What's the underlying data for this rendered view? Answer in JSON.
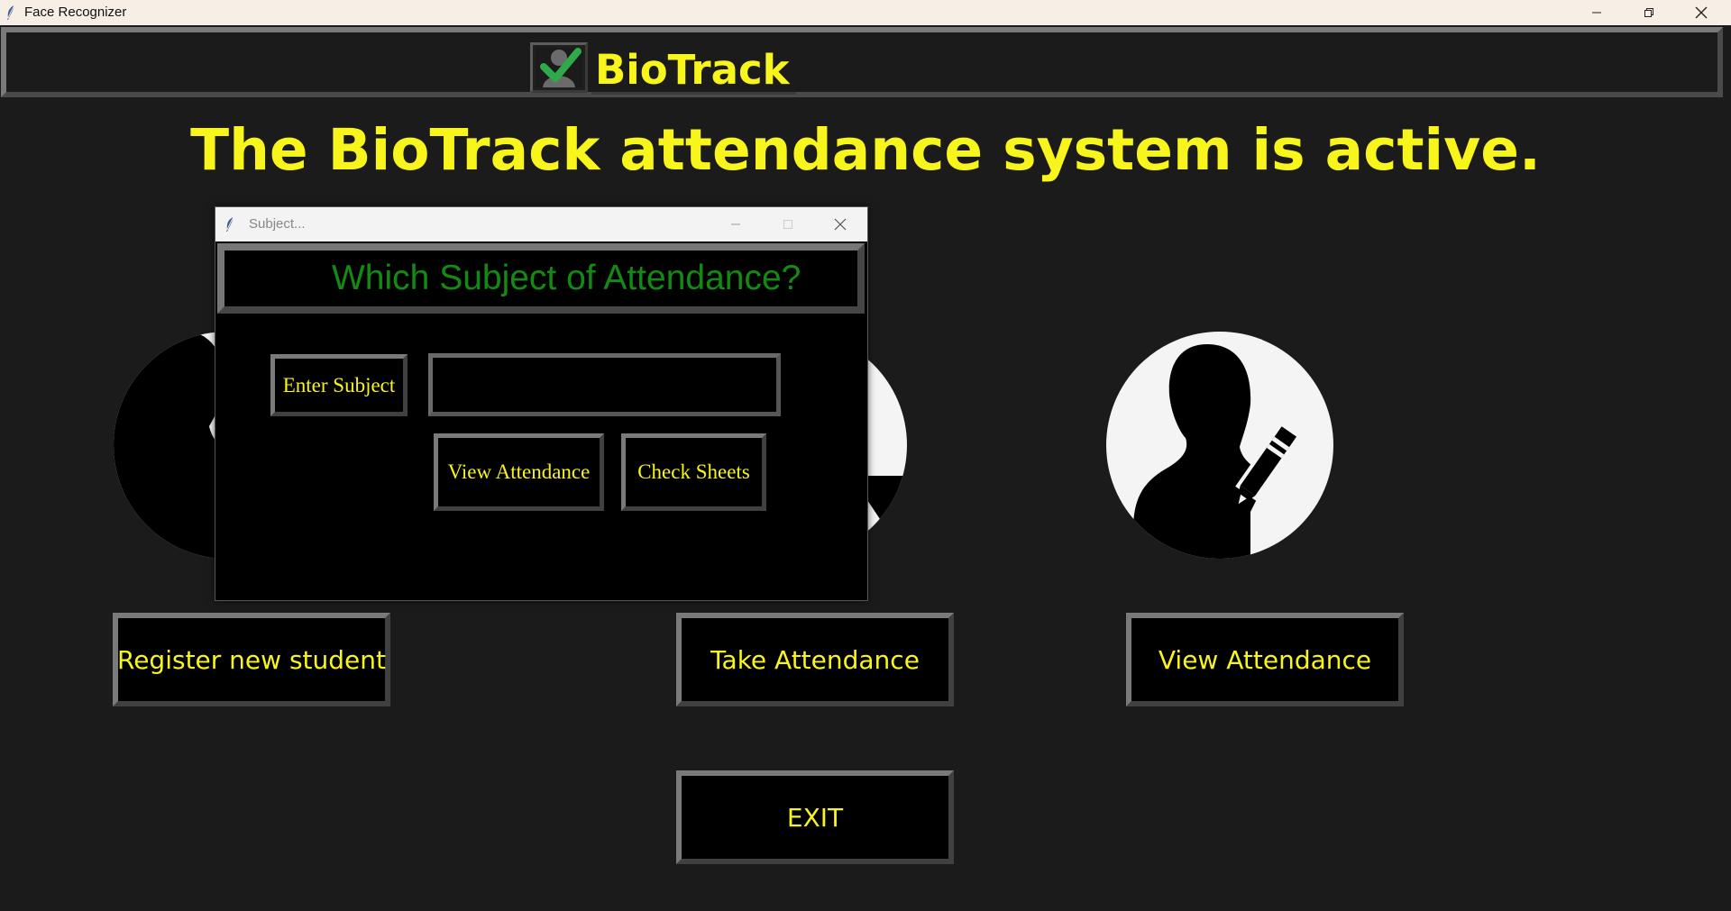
{
  "window": {
    "title": "Face Recognizer",
    "icon": "feather-icon"
  },
  "header": {
    "app_name": "BioTrack",
    "logo_icon": "checkmark-person-icon"
  },
  "headline": "The BioTrack attendance system is active.",
  "main_buttons": {
    "register": "Register new student",
    "take": "Take Attendance",
    "view": "View Attendance",
    "exit": "EXIT"
  },
  "dialog": {
    "title": "Subject...",
    "heading": "Which Subject of Attendance?",
    "enter_subject_label": "Enter Subject",
    "subject_value": "",
    "view_attendance_label": "View Attendance",
    "check_sheets_label": "Check Sheets"
  },
  "colors": {
    "accent_yellow": "#f7f51b",
    "heading_green": "#138a13",
    "background": "#1b1b1b",
    "check_green": "#2eaa4a"
  }
}
